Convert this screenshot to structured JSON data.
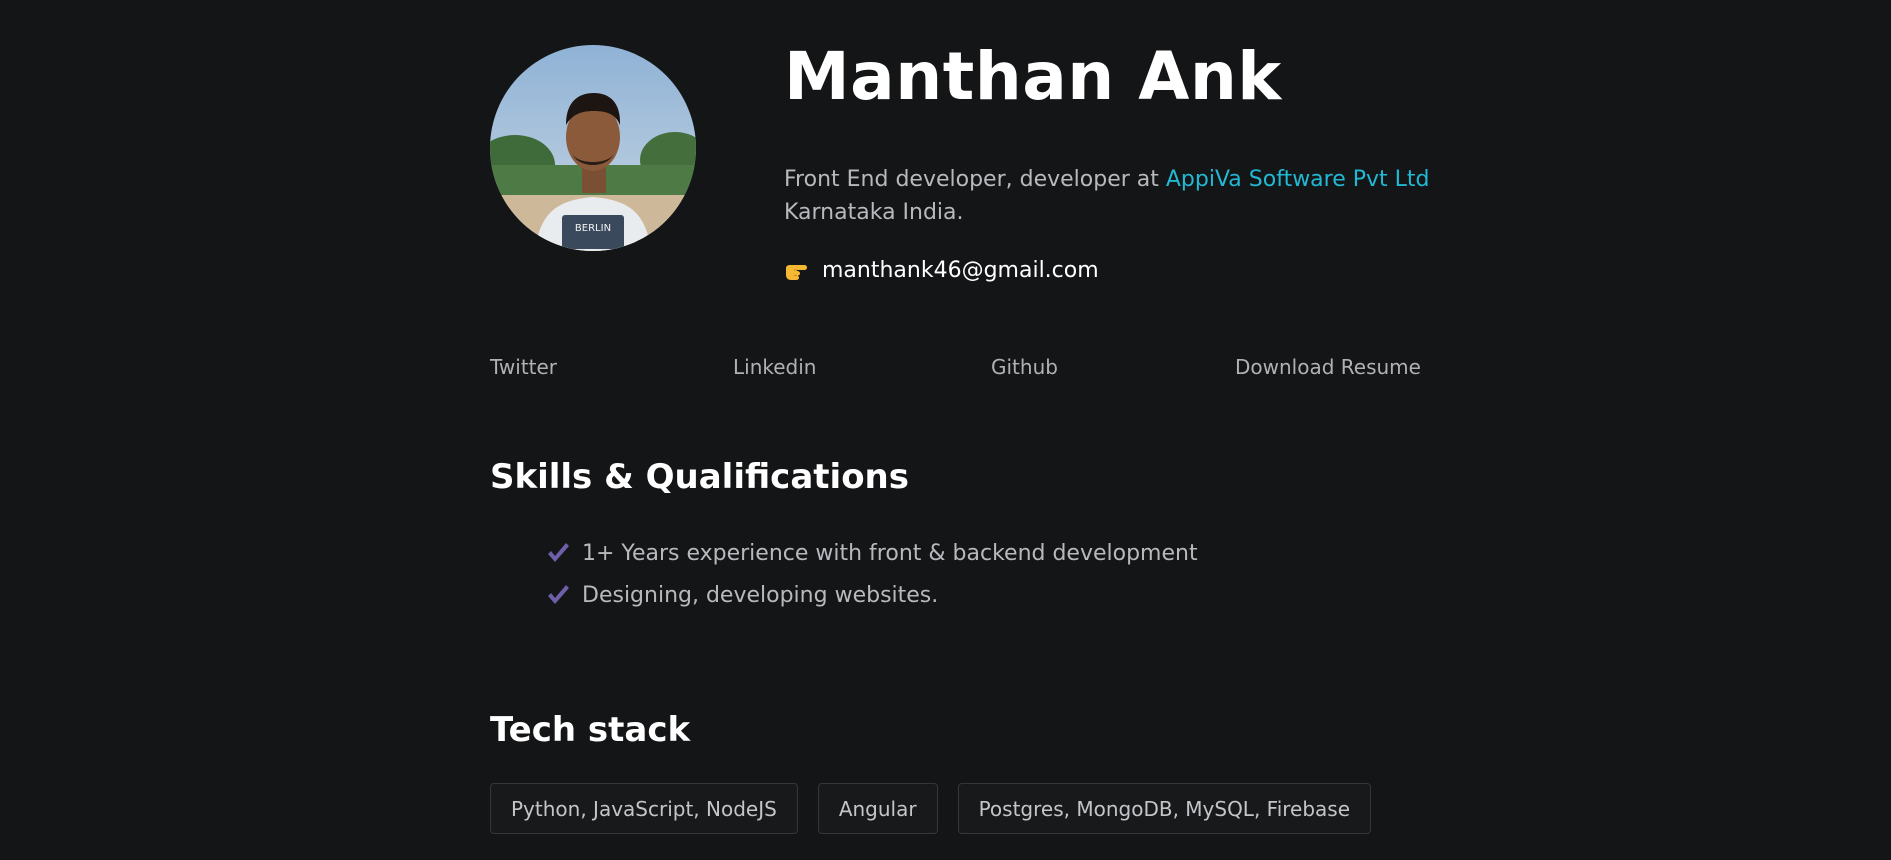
{
  "profile": {
    "name": "Manthan Ank",
    "bio_prefix": "Front End developer, developer at ",
    "company": "AppiVa Software Pvt Ltd",
    "location": "Karnataka India.",
    "email": "manthank46@gmail.com",
    "email_icon": "pointing-hand-icon"
  },
  "links": {
    "twitter": "Twitter",
    "linkedin": "Linkedin",
    "github": "Github",
    "resume": "Download Resume"
  },
  "skills": {
    "title": "Skills & Qualifications",
    "items": [
      "1+ Years experience with front & backend development",
      "Designing, developing websites."
    ]
  },
  "tech": {
    "title": "Tech stack",
    "tags": [
      "Python, JavaScript, NodeJS",
      "Angular",
      "Postgres, MongoDB, MySQL, Firebase"
    ]
  },
  "colors": {
    "background": "#141517",
    "accent_link": "#22b8d4",
    "check": "#6f5ea8",
    "heading": "#ffffff"
  }
}
